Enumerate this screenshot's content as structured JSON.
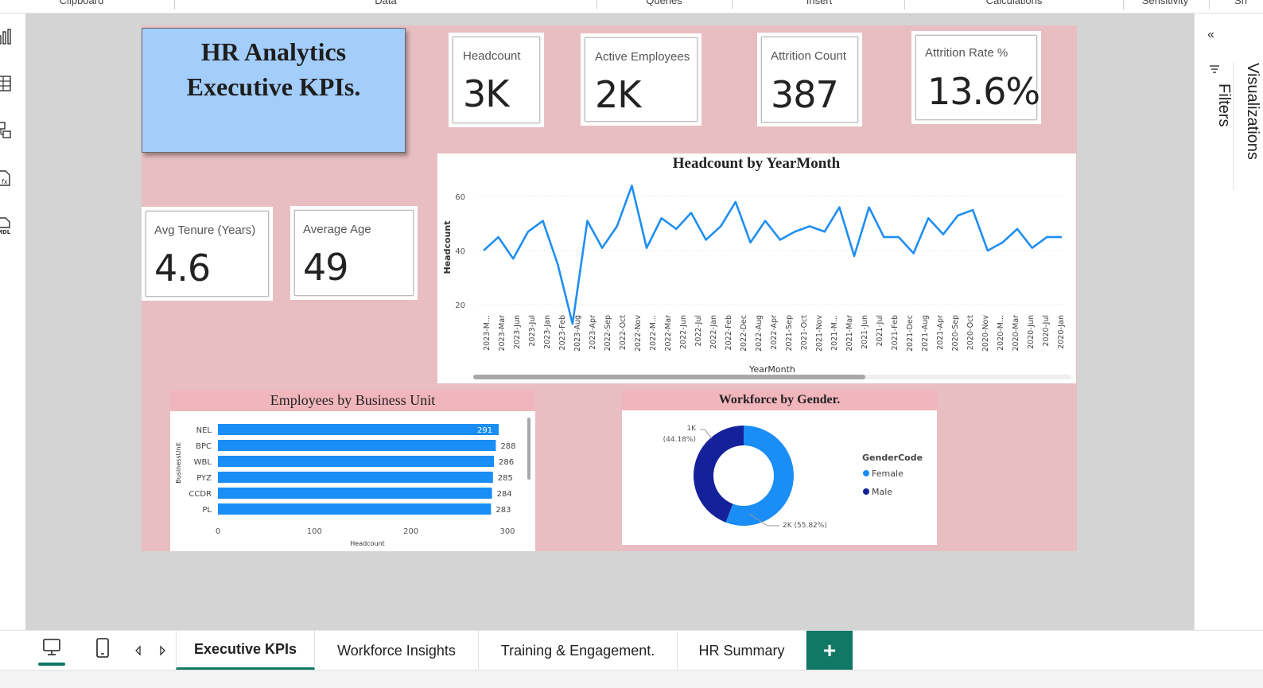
{
  "ribbon": {
    "groups": [
      "Clipboard",
      "Data",
      "Queries",
      "Insert",
      "Calculations",
      "Sensitivity",
      "Sh"
    ]
  },
  "report": {
    "title_line1": "HR Analytics",
    "title_line2": "Executive KPIs.",
    "kpis": [
      {
        "label": "Headcount",
        "value": "3K"
      },
      {
        "label": "Active Employees",
        "value": "2K"
      },
      {
        "label": "Attrition Count",
        "value": "387"
      },
      {
        "label": "Attrition Rate %",
        "value": "13.6%"
      },
      {
        "label": "Avg Tenure (Years)",
        "value": "4.6"
      },
      {
        "label": "Average Age",
        "value": "49"
      }
    ],
    "colors": {
      "canvas_bg": "#e8bec2",
      "title_bg": "#a3cdfa",
      "line": "#1f8ef1",
      "bar": "#1a8ef5",
      "female": "#1a8ef5",
      "male": "#14219a",
      "tab_accent": "#117865"
    }
  },
  "chart_data": [
    {
      "type": "line",
      "title": "Headcount by YearMonth",
      "xlabel": "YearMonth",
      "ylabel": "Headcount",
      "yticks": [
        20,
        40,
        60
      ],
      "ylim": [
        8,
        70
      ],
      "grid": true,
      "x": [
        "2023-M...",
        "2023-Mar",
        "2023-Jun",
        "2023-Jul",
        "2023-Jan",
        "2023-Feb",
        "2023-Aug",
        "2023-Apr",
        "2022-Sep",
        "2022-Oct",
        "2022-Nov",
        "2022-M...",
        "2022-Mar",
        "2022-Jun",
        "2022-Jul",
        "2022-Jan",
        "2022-Feb",
        "2022-Dec",
        "2022-Aug",
        "2022-Apr",
        "2021-Sep",
        "2021-Oct",
        "2021-Nov",
        "2021-M...",
        "2021-Mar",
        "2021-Jun",
        "2021-Jul",
        "2021-Feb",
        "2021-Dec",
        "2021-Aug",
        "2021-Apr",
        "2020-Sep",
        "2020-Oct",
        "2020-Nov",
        "2020-M...",
        "2020-Mar",
        "2020-Jun",
        "2020-Jul",
        "2020-Jan"
      ],
      "values": [
        40,
        45,
        37,
        47,
        51,
        35,
        13,
        51,
        41,
        49,
        64,
        41,
        52,
        48,
        54,
        44,
        49,
        58,
        43,
        51,
        44,
        47,
        49,
        47,
        56,
        38,
        56,
        45,
        45,
        39,
        52,
        46,
        53,
        55,
        40,
        43,
        48,
        41,
        45,
        45
      ]
    },
    {
      "type": "bar",
      "title": "Employees by Business Unit",
      "xlabel": "Headcount",
      "ylabel": "BusinessUnit",
      "orientation": "horizontal",
      "categories": [
        "NEL",
        "BPC",
        "WBL",
        "PYZ",
        "CCDR",
        "PL"
      ],
      "values": [
        291,
        288,
        286,
        285,
        284,
        283
      ],
      "xlim": [
        0,
        300
      ],
      "xticks": [
        0,
        100,
        200,
        300
      ]
    },
    {
      "type": "pie",
      "style": "donut",
      "title": "Workforce by Gender.",
      "legend_title": "GenderCode",
      "legend_position": "right",
      "series": [
        {
          "name": "Female",
          "value": 55.82,
          "label": "2K (55.82%)"
        },
        {
          "name": "Male",
          "value": 44.18,
          "label_value": "1K",
          "label_pct": "(44.18%)"
        }
      ]
    }
  ],
  "right_pane": {
    "filters_label": "Filters",
    "visualizations_label": "Visualizations"
  },
  "tabs": [
    {
      "label": "Executive KPIs",
      "active": true
    },
    {
      "label": "Workforce Insights",
      "active": false
    },
    {
      "label": "Training & Engagement.",
      "active": false
    },
    {
      "label": "HR Summary",
      "active": false
    }
  ],
  "add_tab_label": "+"
}
